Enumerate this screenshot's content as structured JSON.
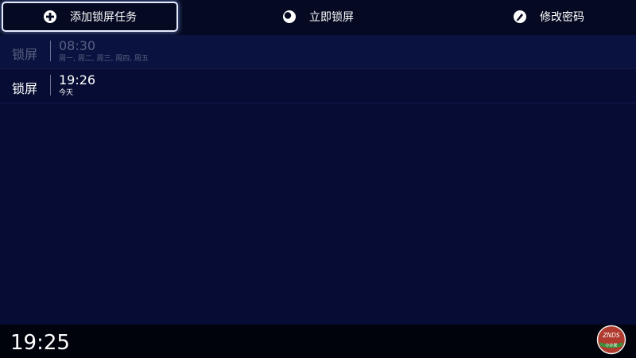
{
  "toolbar": {
    "add_task_label": "添加锁屏任务",
    "lock_now_label": "立即锁屏",
    "change_password_label": "修改密码",
    "icons": {
      "add_task": "plus-circle-icon",
      "lock_now": "half-circle-icon",
      "change_password": "brush-icon"
    },
    "focused_item": "add_task"
  },
  "tasks": [
    {
      "type": "锁屏",
      "time": "08:30",
      "days": "周一, 周二, 周三, 周四, 周五",
      "enabled": false
    },
    {
      "type": "锁屏",
      "time": "19:26",
      "days": "今天",
      "enabled": true
    }
  ],
  "status_bar": {
    "clock": "19:25",
    "logo": {
      "text_top": "ZNDS",
      "text_bottom": "小沙发",
      "icon": "sofa-badge-logo"
    }
  },
  "colors": {
    "background": "#060c33",
    "toolbar_bg": "#050a22",
    "bottom_bar_bg": "#01030c",
    "disabled_text": "#5a6080",
    "focus_border": "#e6ecff"
  }
}
